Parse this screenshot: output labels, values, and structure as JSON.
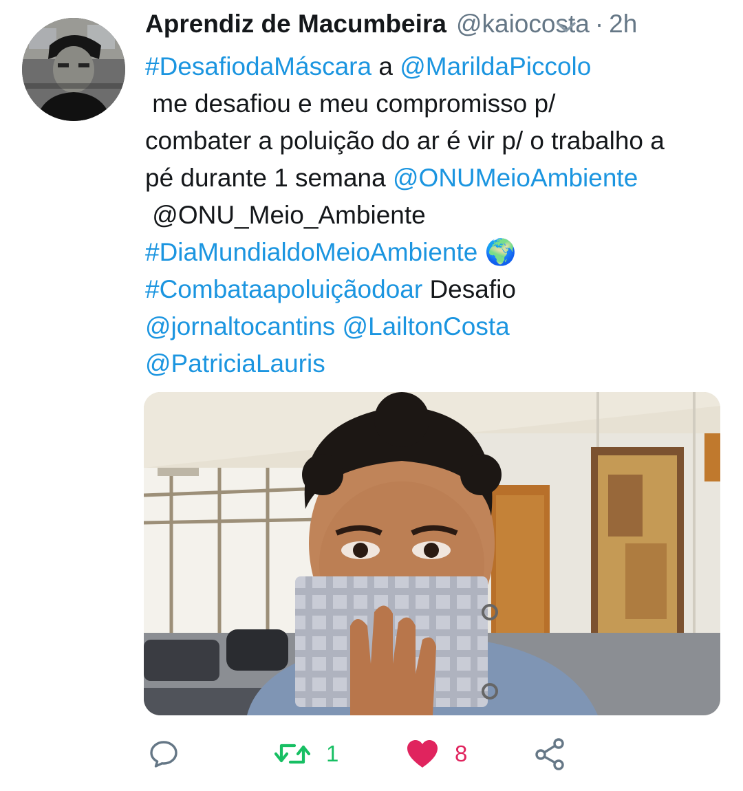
{
  "tweet": {
    "display_name": "Aprendiz de Macumbeira",
    "handle": "@kaiocosta",
    "separator": "·",
    "time": "2h",
    "lines": [
      [
        {
          "t": "#DesafiodaMáscara",
          "link": true
        },
        {
          "t": " a ",
          "link": false
        },
        {
          "t": "@MarildaPiccolo",
          "link": true
        }
      ],
      [
        {
          "t": " me desafiou e meu compromisso p/",
          "link": false
        }
      ],
      [
        {
          "t": "combater a poluição do ar é vir p/ o trabalho a",
          "link": false
        }
      ],
      [
        {
          "t": "pé durante 1 semana ",
          "link": false
        },
        {
          "t": "@ONUMeioAmbiente",
          "link": true
        }
      ],
      [
        {
          "t": " @ONU_Meio_Ambiente",
          "link": false
        }
      ],
      [
        {
          "t": "#DiaMundialdoMeioAmbiente",
          "link": true
        },
        {
          "t": " 🌍",
          "link": false
        }
      ],
      [
        {
          "t": "#Combataapoluiçãodoar",
          "link": true
        },
        {
          "t": " Desafio",
          "link": false
        }
      ],
      [
        {
          "t": "@jornaltocantins",
          "link": true
        },
        {
          "t": " ",
          "link": false
        },
        {
          "t": "@LailtonCosta",
          "link": true
        }
      ],
      [
        {
          "t": "@PatriciaLauris",
          "link": true
        }
      ]
    ]
  },
  "actions": {
    "reply_count": "",
    "retweet_count": "1",
    "like_count": "8"
  },
  "icons": {
    "reply": "reply-icon",
    "retweet": "retweet-icon",
    "like": "heart-icon",
    "share": "share-icon",
    "caret": "chevron-down-icon"
  },
  "colors": {
    "link": "#1b95e0",
    "retweet": "#17bf63",
    "like": "#e0245e",
    "muted": "#657786",
    "icon_gray": "#657786"
  }
}
